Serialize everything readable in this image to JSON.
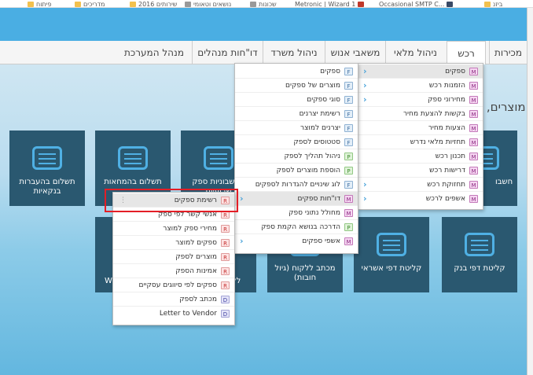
{
  "bookmarks": [
    {
      "label": "ביזנ",
      "icon": "folder-icon"
    },
    {
      "label": "Occasional SMTP C...",
      "icon": "page-icon"
    },
    {
      "label": "Metronic | Wizard 1",
      "icon": "metronic-icon"
    },
    {
      "label": "שכונות",
      "icon": "page-icon"
    },
    {
      "label": "נושאים וטאומי",
      "icon": "page-icon"
    },
    {
      "label": "שירותים 2016",
      "icon": "folder-icon"
    },
    {
      "label": "מדריכים",
      "icon": "folder-icon"
    },
    {
      "label": "פיתוח",
      "icon": "folder-icon"
    }
  ],
  "nav": {
    "items": [
      "מכירות",
      "רכש",
      "ניהול מלאי",
      "משאבי אנוש",
      "ניהול משרד",
      "דו\"חות מנהלים",
      "מנהל המערכת"
    ],
    "active": "רכש"
  },
  "page": {
    "title": "מוצרים, מכ"
  },
  "tiles": [
    {
      "label": "תשלום בהעברות בנקאיות"
    },
    {
      "label": "תשלום בהמחאות"
    },
    {
      "label": "התשבוניות ספק שבועיות"
    },
    {
      "label": "חשבו"
    },
    {
      "label": "W"
    },
    {
      "label": "לל"
    },
    {
      "label": "מכתב ללקוח (גיול חובות)"
    },
    {
      "label": "קליטת דפי אשראי"
    },
    {
      "label": "קליטת דפי בנק"
    }
  ],
  "menu_l1": [
    {
      "label": "ספקים",
      "badge": "M",
      "chevron": true
    },
    {
      "label": "הזמנות רכש",
      "badge": "M",
      "chevron": true
    },
    {
      "label": "מחירוני ספק",
      "badge": "M",
      "chevron": true
    },
    {
      "label": "בקשות להצעת מחיר",
      "badge": "M",
      "chevron": false
    },
    {
      "label": "הצעות מחיר",
      "badge": "M",
      "chevron": false
    },
    {
      "label": "תחזיות מלאי נדרש",
      "badge": "M",
      "chevron": false
    },
    {
      "label": "תכנון רכש",
      "badge": "M",
      "chevron": false
    },
    {
      "label": "דרישות רכש",
      "badge": "M",
      "chevron": false
    },
    {
      "label": "תחזוקת רכש",
      "badge": "M",
      "chevron": true
    },
    {
      "label": "אשפים לרכש",
      "badge": "M",
      "chevron": true
    }
  ],
  "menu_l2": [
    {
      "label": "ספקים",
      "badge": "F",
      "chevron": false
    },
    {
      "label": "מוצרים של ספקים",
      "badge": "F",
      "chevron": false
    },
    {
      "label": "סוגי ספקים",
      "badge": "F",
      "chevron": false
    },
    {
      "label": "רשימת יצרנים",
      "badge": "F",
      "chevron": false
    },
    {
      "label": "יצרנים למוצר",
      "badge": "F",
      "chevron": false
    },
    {
      "label": "סטטוסים לספק",
      "badge": "F",
      "chevron": false
    },
    {
      "label": "ניהול תהליך לספק",
      "badge": "P",
      "chevron": false
    },
    {
      "label": "הוספת מוצרים לספק",
      "badge": "P",
      "chevron": false
    },
    {
      "label": "לוג שינויים להגדרות לספקים",
      "badge": "F",
      "chevron": false
    },
    {
      "label": "דו\"חות ספקים",
      "badge": "M",
      "chevron": true
    },
    {
      "label": "מחולל נתוני ספק",
      "badge": "M",
      "chevron": false
    },
    {
      "label": "הדרכה בנושא הקמת ספק",
      "badge": "P",
      "chevron": false
    },
    {
      "label": "אשפי ספקים",
      "badge": "M",
      "chevron": true
    }
  ],
  "menu_l3": [
    {
      "label": "רשימת ספקים",
      "badge": "R"
    },
    {
      "label": "אנשי קשר לפי ספק",
      "badge": "R"
    },
    {
      "label": "מחירי ספק למוצר",
      "badge": "R"
    },
    {
      "label": "ספקים למוצר",
      "badge": "R"
    },
    {
      "label": "מוצרים לספק",
      "badge": "R"
    },
    {
      "label": "אמינות הספק",
      "badge": "R"
    },
    {
      "label": "ספקים לפי סיווגים עסקיים",
      "badge": "R"
    },
    {
      "label": "מכתב לספק",
      "badge": "D"
    },
    {
      "label": "Letter to Vendor",
      "badge": "D"
    }
  ]
}
